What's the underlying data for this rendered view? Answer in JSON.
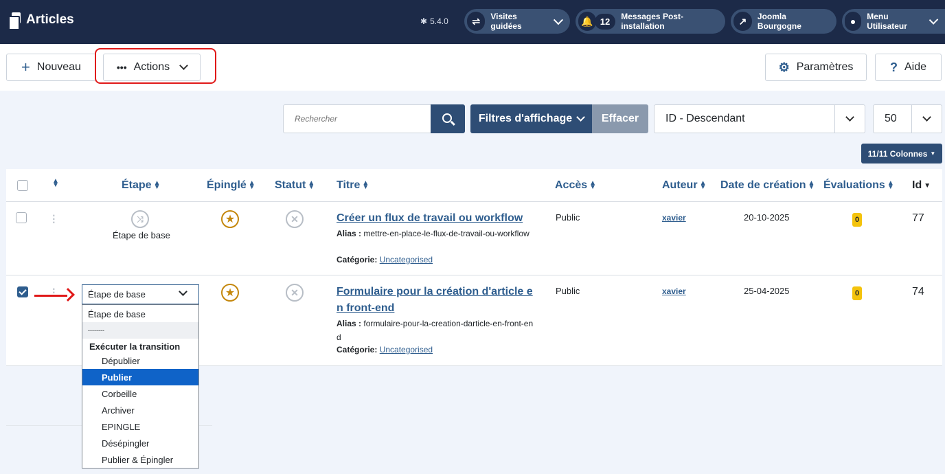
{
  "header": {
    "title": "Articles",
    "version": "5.4.0",
    "tours_label": "Visites guidées",
    "messages_count": "12",
    "messages_label": "Messages Post-installation",
    "site_label": "Joomla Bourgogne",
    "user_menu_label": "Menu Utilisateur"
  },
  "toolbar": {
    "new_label": "Nouveau",
    "actions_label": "Actions",
    "options_label": "Paramètres",
    "help_label": "Aide"
  },
  "filters": {
    "search_placeholder": "Rechercher",
    "filter_label": "Filtres d'affichage",
    "clear_label": "Effacer",
    "ordering_value": "ID - Descendant",
    "limit_value": "50",
    "columns_label": "11/11 Colonnes"
  },
  "table": {
    "columns": {
      "stage": "Étape",
      "featured": "Épinglé",
      "status": "Statut",
      "title": "Titre",
      "access": "Accès",
      "author": "Auteur",
      "created": "Date de création",
      "votes": "Évaluations",
      "id": "Id"
    },
    "rows": [
      {
        "stage": "Étape de base",
        "title": "Créer un flux de travail ou workflow",
        "alias_label": "Alias :",
        "alias": "mettre-en-place-le-flux-de-travail-ou-workflow",
        "category_label": "Catégorie:",
        "category": "Uncategorised",
        "access": "Public",
        "author": "xavier",
        "created": "20-10-2025",
        "votes": "0",
        "id": "77"
      },
      {
        "stage": "Étape de base",
        "title": "Formulaire pour la création d'article en front-end",
        "alias_label": "Alias :",
        "alias": "formulaire-pour-la-creation-darticle-en-front-end",
        "category_label": "Catégorie:",
        "category": "Uncategorised",
        "access": "Public",
        "author": "xavier",
        "created": "25-04-2025",
        "votes": "0",
        "id": "74"
      }
    ]
  },
  "stage_dropdown": {
    "selected": "Étape de base",
    "options": [
      "Étape de base",
      "--------",
      "Exécuter la transition",
      "Dépublier",
      "Publier",
      "Corbeille",
      "Archiver",
      "EPINGLE",
      "Désépingler",
      "Publier & Épingler"
    ],
    "active_option": "Publier"
  },
  "colors": {
    "header_bg": "#1c2a48",
    "primary": "#2e4d75",
    "link": "#2e5d8e",
    "highlight": "#e01818",
    "active_option": "#0f63c8",
    "badge": "#f4c30c"
  }
}
